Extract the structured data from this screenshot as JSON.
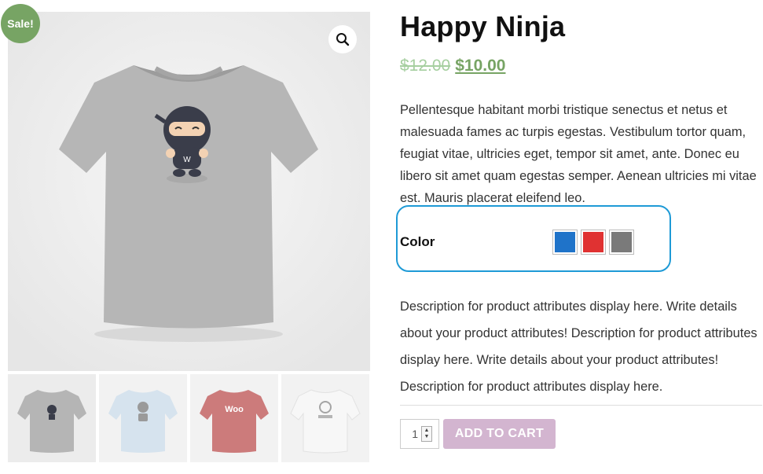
{
  "product": {
    "title": "Happy Ninja",
    "sale_badge": "Sale!",
    "old_price": "$12.00",
    "price": "$10.00",
    "short_description": "Pellentesque habitant morbi tristique senectus et netus et malesuada fames ac turpis egestas. Vestibulum tortor quam, feugiat vitae, ultricies eget, tempor sit amet, ante. Donec eu libero sit amet quam egestas semper. Aenean ultricies mi vitae est. Mauris placerat eleifend leo.",
    "attribute_description": "Description for product attributes display here. Write details about your product attributes! Description for product attributes display here. Write details about your product attributes! Description for product attributes display here."
  },
  "attribute": {
    "label": "Color",
    "swatches": [
      {
        "name": "blue",
        "color": "#1f73c9"
      },
      {
        "name": "red",
        "color": "#e03232"
      },
      {
        "name": "gray",
        "color": "#7a7a7a"
      }
    ]
  },
  "cart": {
    "quantity": "1",
    "add_to_cart_label": "ADD TO CART"
  },
  "gallery": {
    "thumbnail_logo_text": "Woo",
    "icons": [
      "zoom-icon"
    ]
  },
  "colors": {
    "sale": "#77a464",
    "button": "#d3b5d0",
    "highlight": "#1e9ad6"
  }
}
